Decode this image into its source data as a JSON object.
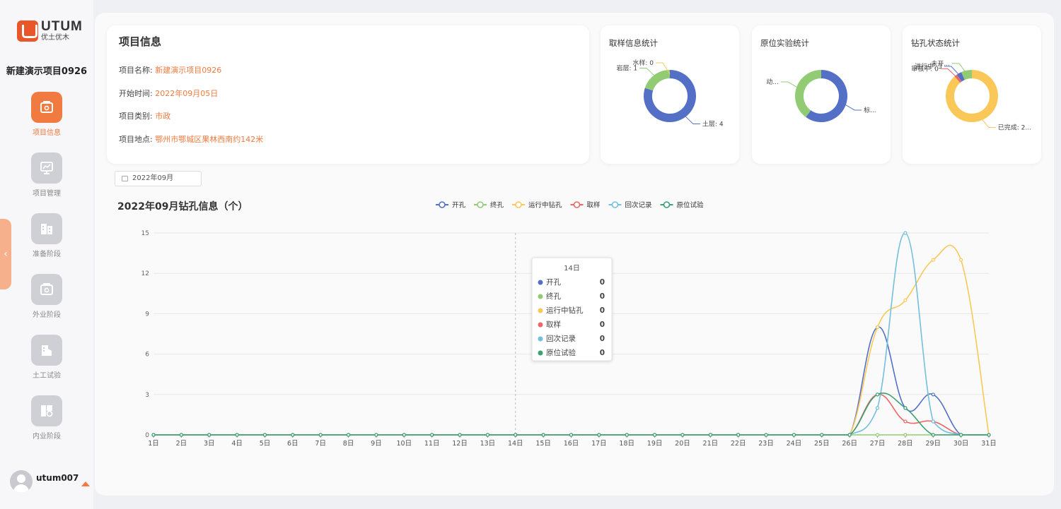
{
  "brand": {
    "name_en": "UTUM",
    "name_cn": "优土优木"
  },
  "project_title": "新建演示项目0926",
  "nav": [
    {
      "label": "项目信息",
      "icon": "project-info-icon",
      "active": true
    },
    {
      "label": "项目管理",
      "icon": "chart-board-icon",
      "active": false
    },
    {
      "label": "准备阶段",
      "icon": "building-icon",
      "active": false
    },
    {
      "label": "外业阶段",
      "icon": "field-work-icon",
      "active": false
    },
    {
      "label": "土工试验",
      "icon": "soil-test-icon",
      "active": false
    },
    {
      "label": "内业阶段",
      "icon": "office-work-icon",
      "active": false
    }
  ],
  "user": {
    "name": "utum007"
  },
  "info": {
    "title": "项目信息",
    "rows": [
      {
        "label": "项目名称:",
        "value": "新建演示项目0926"
      },
      {
        "label": "开始时间:",
        "value": "2022年09月05日"
      },
      {
        "label": "项目类别:",
        "value": "市政"
      },
      {
        "label": "项目地点:",
        "value": "鄂州市鄂城区果林西南约142米"
      }
    ]
  },
  "stats": [
    {
      "title": "取样信息统计",
      "slices": [
        {
          "name": "土层",
          "label": "土层: 4",
          "value": 4,
          "color": "#5470c6"
        },
        {
          "name": "岩层",
          "label": "岩层: 1",
          "value": 1,
          "color": "#91cc75"
        },
        {
          "name": "水样",
          "label": "水样: 0",
          "value": 0,
          "color": "#fac858"
        }
      ]
    },
    {
      "title": "原位实验统计",
      "slices": [
        {
          "name": "标...",
          "label": "标...",
          "value": 6,
          "color": "#5470c6"
        },
        {
          "name": "动...",
          "label": "动...",
          "value": 4,
          "color": "#91cc75"
        }
      ]
    },
    {
      "title": "钻孔状态统计",
      "slices": [
        {
          "name": "已完成",
          "label": "已完成: 2...",
          "value": 20,
          "color": "#fac858"
        },
        {
          "name": "审核中",
          "label": "审核中: 0",
          "value": 0.4,
          "color": "#ee6666"
        },
        {
          "name": "进行中",
          "label": "进行中: 3",
          "value": 0.7,
          "color": "#5470c6"
        },
        {
          "name": "未开...",
          "label": "未开...",
          "value": 1.5,
          "color": "#91cc75"
        }
      ]
    }
  ],
  "date_picker": {
    "value": "2022年09月"
  },
  "chart_data": {
    "type": "line",
    "title": "2022年09月钻孔信息（个）",
    "categories": [
      "1日",
      "2日",
      "3日",
      "4日",
      "5日",
      "6日",
      "7日",
      "8日",
      "9日",
      "10日",
      "11日",
      "12日",
      "13日",
      "14日",
      "15日",
      "16日",
      "17日",
      "18日",
      "19日",
      "20日",
      "21日",
      "22日",
      "23日",
      "24日",
      "25日",
      "26日",
      "27日",
      "28日",
      "29日",
      "30日",
      "31日"
    ],
    "ylim": [
      0,
      15
    ],
    "yticks": [
      0,
      3,
      6,
      9,
      12,
      15
    ],
    "grid": true,
    "legend_position": "top",
    "series": [
      {
        "name": "开孔",
        "color": "#5470c6",
        "values": [
          0,
          0,
          0,
          0,
          0,
          0,
          0,
          0,
          0,
          0,
          0,
          0,
          0,
          0,
          0,
          0,
          0,
          0,
          0,
          0,
          0,
          0,
          0,
          0,
          0,
          0,
          8,
          2,
          3,
          0,
          0
        ]
      },
      {
        "name": "终孔",
        "color": "#91cc75",
        "values": [
          0,
          0,
          0,
          0,
          0,
          0,
          0,
          0,
          0,
          0,
          0,
          0,
          0,
          0,
          0,
          0,
          0,
          0,
          0,
          0,
          0,
          0,
          0,
          0,
          0,
          0,
          0,
          0,
          0,
          0,
          0
        ]
      },
      {
        "name": "运行中钻孔",
        "color": "#fac858",
        "values": [
          0,
          0,
          0,
          0,
          0,
          0,
          0,
          0,
          0,
          0,
          0,
          0,
          0,
          0,
          0,
          0,
          0,
          0,
          0,
          0,
          0,
          0,
          0,
          0,
          0,
          0,
          8,
          10,
          13,
          13,
          0
        ]
      },
      {
        "name": "取样",
        "color": "#ee6666",
        "values": [
          0,
          0,
          0,
          0,
          0,
          0,
          0,
          0,
          0,
          0,
          0,
          0,
          0,
          0,
          0,
          0,
          0,
          0,
          0,
          0,
          0,
          0,
          0,
          0,
          0,
          0,
          3,
          1,
          1,
          0,
          0
        ]
      },
      {
        "name": "回次记录",
        "color": "#73c0de",
        "values": [
          0,
          0,
          0,
          0,
          0,
          0,
          0,
          0,
          0,
          0,
          0,
          0,
          0,
          0,
          0,
          0,
          0,
          0,
          0,
          0,
          0,
          0,
          0,
          0,
          0,
          0,
          2,
          15,
          1,
          0,
          0
        ]
      },
      {
        "name": "原位试验",
        "color": "#3ba272",
        "values": [
          0,
          0,
          0,
          0,
          0,
          0,
          0,
          0,
          0,
          0,
          0,
          0,
          0,
          0,
          0,
          0,
          0,
          0,
          0,
          0,
          0,
          0,
          0,
          0,
          0,
          0,
          3,
          2,
          0,
          0,
          0
        ]
      }
    ],
    "tooltip": {
      "category": "14日",
      "rows": [
        {
          "name": "开孔",
          "value": "0",
          "color": "#5470c6"
        },
        {
          "name": "终孔",
          "value": "0",
          "color": "#91cc75"
        },
        {
          "name": "运行中钻孔",
          "value": "0",
          "color": "#fac858"
        },
        {
          "name": "取样",
          "value": "0",
          "color": "#ee6666"
        },
        {
          "name": "回次记录",
          "value": "0",
          "color": "#73c0de"
        },
        {
          "name": "原位试验",
          "value": "0",
          "color": "#3ba272"
        }
      ]
    }
  }
}
